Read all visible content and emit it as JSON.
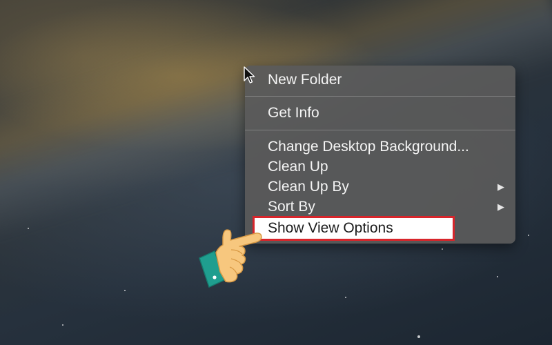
{
  "context_menu": {
    "items": [
      {
        "label": "New Folder"
      },
      {
        "label": "Get Info"
      },
      {
        "label": "Change Desktop Background..."
      },
      {
        "label": "Clean Up"
      },
      {
        "label": "Clean Up By",
        "submenu_arrow": "▶"
      },
      {
        "label": "Sort By",
        "submenu_arrow": "▶"
      },
      {
        "label": "Show View Options",
        "highlighted": true
      }
    ]
  },
  "colors": {
    "highlight_border": "#d8252b",
    "menu_background": "#5a5a5a",
    "hand_skin": "#f7c77e",
    "hand_cuff": "#1f9e8f"
  },
  "icons": {
    "cursor": "arrow-cursor-icon",
    "pointer_hand": "pointing-hand-icon"
  }
}
